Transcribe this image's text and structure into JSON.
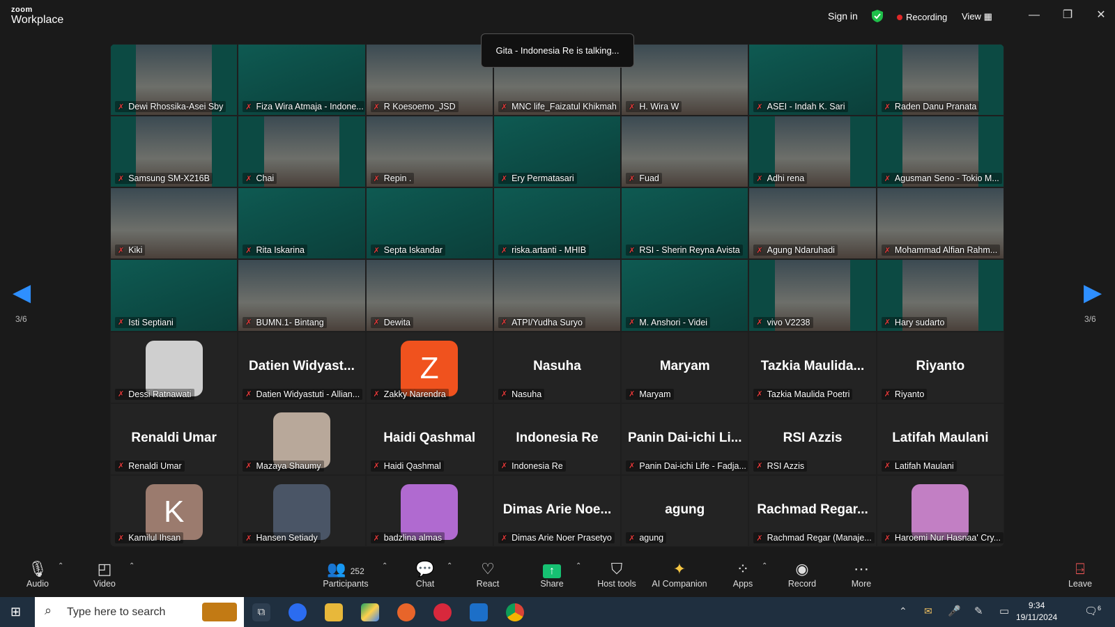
{
  "app": {
    "logo_top": "zoom",
    "logo_bottom": "Workplace"
  },
  "header": {
    "sign_in": "Sign in",
    "recording": "Recording",
    "view": "View"
  },
  "toast": "Gita - Indonesia Re is talking...",
  "pager": {
    "left": "3/6",
    "right": "3/6"
  },
  "participants_grid": [
    {
      "name": "Dewi Rhossika-Asei Sby",
      "type": "video"
    },
    {
      "name": "Fiza Wira Atmaja - Indone...",
      "type": "video",
      "bg": "green"
    },
    {
      "name": "R Koesoemo_JSD",
      "type": "video"
    },
    {
      "name": "MNC life_Faizatul Khikmah",
      "type": "video"
    },
    {
      "name": "H. Wira W",
      "type": "video"
    },
    {
      "name": "ASEI - Indah K. Sari",
      "type": "video",
      "bg": "green"
    },
    {
      "name": "Raden Danu Pranata",
      "type": "video"
    },
    {
      "name": "Samsung SM-X216B",
      "type": "video"
    },
    {
      "name": "Chai",
      "type": "video"
    },
    {
      "name": "Repin .",
      "type": "video"
    },
    {
      "name": "Ery Permatasari",
      "type": "video",
      "bg": "green"
    },
    {
      "name": "Fuad",
      "type": "video"
    },
    {
      "name": "Adhi rena",
      "type": "video"
    },
    {
      "name": "Agusman Seno - Tokio M...",
      "type": "video"
    },
    {
      "name": "Kiki",
      "type": "video"
    },
    {
      "name": "Rita Iskarina",
      "type": "video",
      "bg": "green"
    },
    {
      "name": "Septa Iskandar",
      "type": "video",
      "bg": "green"
    },
    {
      "name": "riska.artanti - MHIB",
      "type": "video",
      "bg": "green"
    },
    {
      "name": "RSI - Sherin Reyna Avista",
      "type": "video",
      "bg": "green"
    },
    {
      "name": "Agung Ndaruhadi",
      "type": "video"
    },
    {
      "name": "Mohammad Alfian Rahm...",
      "type": "video"
    },
    {
      "name": "Isti Septiani",
      "type": "video",
      "bg": "green"
    },
    {
      "name": "BUMN.1- Bintang",
      "type": "video"
    },
    {
      "name": "Dewita",
      "type": "video"
    },
    {
      "name": "ATPI/Yudha Suryo",
      "type": "video"
    },
    {
      "name": "M. Anshori - Videi",
      "type": "video",
      "bg": "green"
    },
    {
      "name": "vivo V2238",
      "type": "video"
    },
    {
      "name": "Hary sudarto",
      "type": "video"
    },
    {
      "name": "Dessi Ratnawati",
      "type": "avatar",
      "avatar_color": "#cfcfcf"
    },
    {
      "name": "Datien Widyastuti - Allian...",
      "type": "text",
      "display": "Datien Widyast..."
    },
    {
      "name": "Zakky Narendra",
      "type": "avatar",
      "letter": "Z",
      "avatar_color": "#f0521e"
    },
    {
      "name": "Nasuha",
      "type": "text",
      "display": "Nasuha"
    },
    {
      "name": "Maryam",
      "type": "text",
      "display": "Maryam"
    },
    {
      "name": "Tazkia Maulida Poetri",
      "type": "text",
      "display": "Tazkia Maulida..."
    },
    {
      "name": "Riyanto",
      "type": "text",
      "display": "Riyanto"
    },
    {
      "name": "Renaldi Umar",
      "type": "text",
      "display": "Renaldi Umar"
    },
    {
      "name": "Mazaya Shaumy",
      "type": "avatar",
      "avatar_color": "#b8a89a"
    },
    {
      "name": "Haidi Qashmal",
      "type": "text",
      "display": "Haidi Qashmal"
    },
    {
      "name": "Indonesia Re",
      "type": "text",
      "display": "Indonesia Re"
    },
    {
      "name": "Panin Dai-ichi Life - Fadja...",
      "type": "text",
      "display": "Panin Dai-ichi Li..."
    },
    {
      "name": "RSI Azzis",
      "type": "text",
      "display": "RSI Azzis"
    },
    {
      "name": "Latifah Maulani",
      "type": "text",
      "display": "Latifah Maulani"
    },
    {
      "name": "Kamilul Ihsan",
      "type": "avatar",
      "letter": "K",
      "avatar_color": "#9b7b6e"
    },
    {
      "name": "Hansen Setiady",
      "type": "avatar",
      "avatar_color": "#4a5566"
    },
    {
      "name": "badzlina almas",
      "type": "avatar",
      "avatar_color": "#b06ad0"
    },
    {
      "name": "Dimas Arie Noer Prasetyo",
      "type": "text",
      "display": "Dimas Arie Noe..."
    },
    {
      "name": "agung",
      "type": "text",
      "display": "agung"
    },
    {
      "name": "Rachmad Regar (Manaje...",
      "type": "text",
      "display": "Rachmad Regar..."
    },
    {
      "name": "Haroemi Nur Hasnaa' Cry...",
      "type": "avatar",
      "avatar_color": "#c27fc4"
    }
  ],
  "toolbar": {
    "audio": "Audio",
    "video": "Video",
    "participants": "Participants",
    "participants_count": "252",
    "chat": "Chat",
    "react": "React",
    "share": "Share",
    "host_tools": "Host tools",
    "ai_companion": "AI Companion",
    "apps": "Apps",
    "record": "Record",
    "more": "More",
    "leave": "Leave"
  },
  "taskbar": {
    "search_placeholder": "Type here to search",
    "time": "9:34",
    "date": "19/11/2024",
    "notifications": "6"
  },
  "colors": {
    "accent": "#2e8fff",
    "mute_red": "#e23a3a",
    "share_green": "#16c172",
    "tile_green": "#0c4a43"
  }
}
